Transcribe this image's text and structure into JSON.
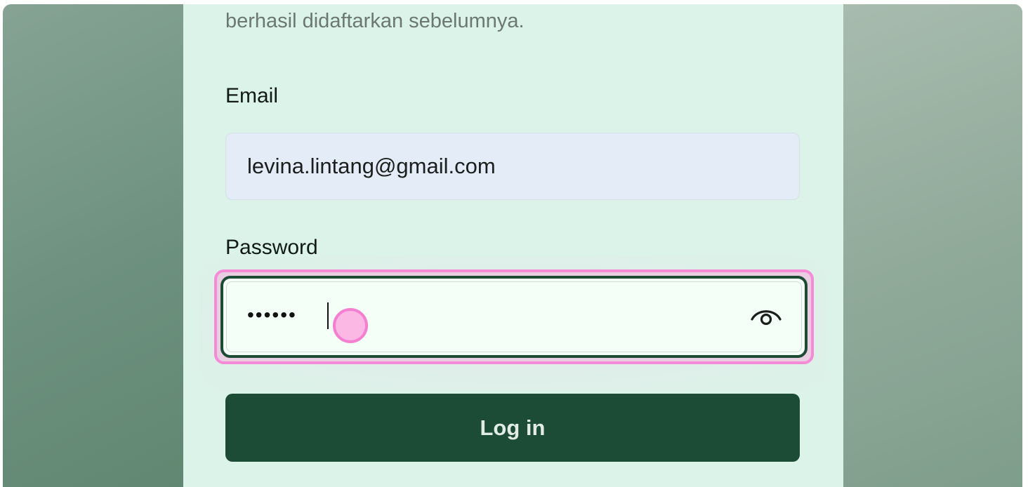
{
  "form": {
    "subtitle_tail": "berhasil didaftarkan sebelumnya.",
    "email_label": "Email",
    "email_value": "levina.lintang@gmail.com",
    "password_label": "Password",
    "password_masked": "••••••",
    "toggle_icon": "eye-icon",
    "login_label": "Log in"
  },
  "colors": {
    "primary": "#1c4c35",
    "card_background": "#dbf3e8",
    "highlight": "#f58ad7",
    "email_field_background": "#e4ecf8"
  }
}
